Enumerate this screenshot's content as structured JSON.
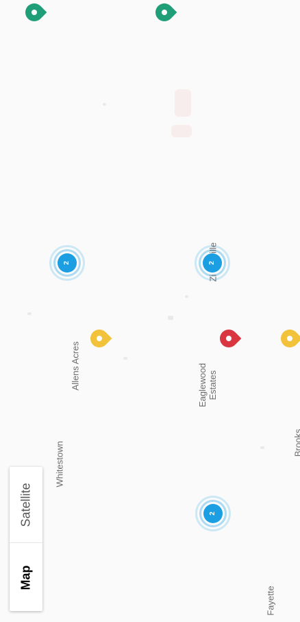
{
  "map_type_control": {
    "map_label": "Map",
    "satellite_label": "Satellite",
    "selected": "Map"
  },
  "places": {
    "whitestown": "Whitestown",
    "allens_acres": "Allens Acres",
    "eaglewood_estates_line1": "Eaglewood",
    "eaglewood_estates_line2": "Estates",
    "zionsville_partial": "Zi",
    "zionsville_partial_end": "ille",
    "fayette": "Fayette",
    "brooks_partial": "Brooks"
  },
  "clusters": [
    {
      "count": "2",
      "color": "#1b9fe2"
    },
    {
      "count": "2",
      "color": "#1b9fe2"
    },
    {
      "count": "2",
      "color": "#1b9fe2"
    }
  ],
  "pins": [
    {
      "color": "#1f9e78",
      "icon": "map-pin-icon"
    },
    {
      "color": "#1f9e78",
      "icon": "map-pin-icon"
    },
    {
      "color": "#f2c23a",
      "icon": "map-pin-icon"
    },
    {
      "color": "#d93641",
      "icon": "map-pin-icon"
    },
    {
      "color": "#f2c23a",
      "icon": "map-pin-icon"
    }
  ]
}
